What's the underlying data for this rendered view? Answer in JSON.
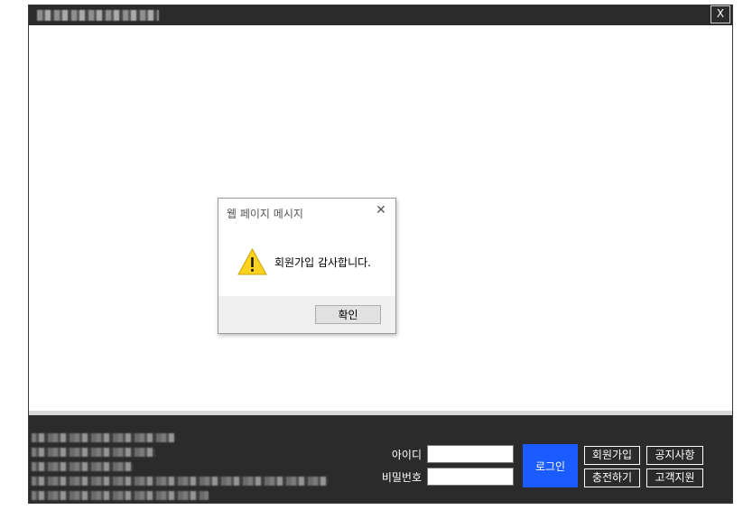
{
  "window": {
    "close_label": "X"
  },
  "footer": {
    "id_label": "아이디",
    "pw_label": "비밀번호",
    "id_value": "",
    "pw_value": "",
    "login_button": "로그인",
    "signup_button": "회원가입",
    "notice_button": "공지사항",
    "charge_button": "충전하기",
    "support_button": "고객지원"
  },
  "dialog": {
    "title": "웹 페이지 메시지",
    "message": "회원가입 감사합니다.",
    "ok_button": "확인",
    "icon": "warning-icon"
  },
  "colors": {
    "titlebar": "#2b2b2b",
    "footer": "#2b2b2b",
    "login_button": "#1a5cff",
    "warning": "#ffd21f"
  }
}
